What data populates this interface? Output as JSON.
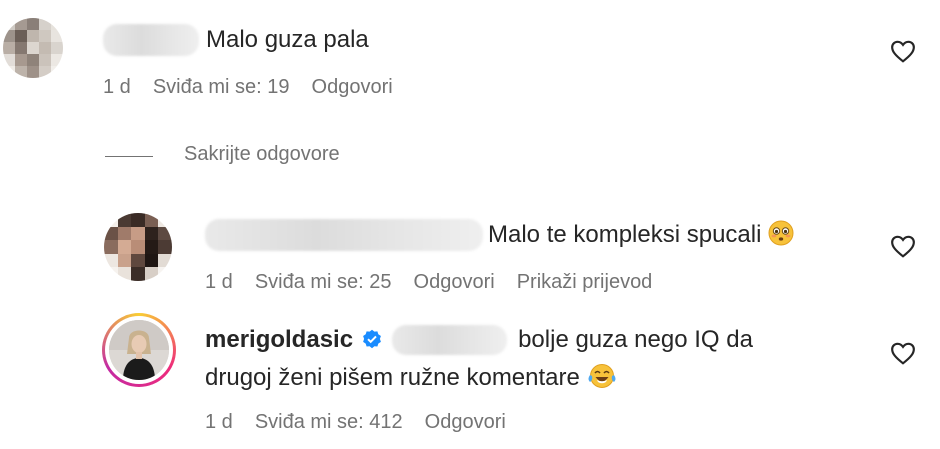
{
  "comments": [
    {
      "text": "Malo guza pala",
      "meta": {
        "time": "1 d",
        "likes": "Sviđa mi se: 19",
        "reply": "Odgovori"
      }
    }
  ],
  "hide_replies": "Sakrijte odgovore",
  "replies": [
    {
      "text": "Malo te kompleksi spucali",
      "meta": {
        "time": "1 d",
        "likes": "Sviđa mi se: 25",
        "reply": "Odgovori",
        "translate": "Prikaži prijevod"
      }
    },
    {
      "username": "merigoldasic",
      "text_line1": "bolje guza nego IQ da",
      "text_line2": "drugoj ženi pišem ružne komentare",
      "meta": {
        "time": "1 d",
        "likes": "Sviđa mi se: 412",
        "reply": "Odgovori"
      }
    }
  ],
  "icons": {
    "heart": "heart-outline-icon",
    "verified": "verified-badge-icon",
    "emoji_flushed": "flushed-face-emoji",
    "emoji_laugh": "tears-of-joy-emoji"
  },
  "colors": {
    "verified": "#1a8cff",
    "story_ring_start": "#f9ce34",
    "story_ring_end": "#c32aa3",
    "meta_text": "#737373"
  }
}
